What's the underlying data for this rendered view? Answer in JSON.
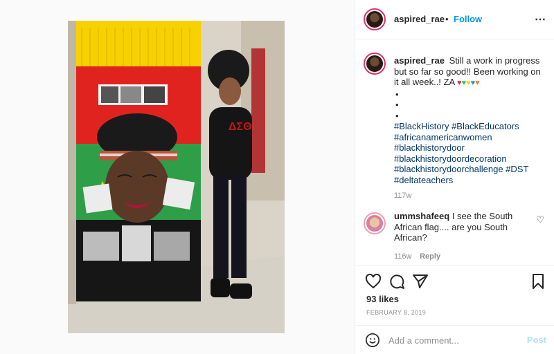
{
  "header": {
    "username": "aspired_rae",
    "separator": "•",
    "follow_label": "Follow",
    "more_icon": "more-horizontal-icon"
  },
  "caption": {
    "username": "aspired_rae",
    "text": "Still a work in progress but so far so good!! Been working on it all week..! ZA",
    "hearts": [
      "#e0245e",
      "#2ecc40",
      "#ffd000",
      "#1e90ff",
      "#ff7f1e"
    ],
    "bullets": [
      "•",
      "•",
      "•"
    ],
    "hashtags": [
      "#BlackHistory #BlackEducators",
      "#africanamericanwomen",
      "#blackhistorydoor",
      "#blackhistorydoordecoration",
      "#blackhistorydoorchallenge #DST",
      "#deltateachers"
    ],
    "time": "117w"
  },
  "comment": {
    "username": "ummshafeeq",
    "text": "I see the South African flag.... are you South African?",
    "time": "116w",
    "reply_label": "Reply"
  },
  "actions": {
    "likes": "93 likes",
    "date": "FEBRUARY 8, 2019"
  },
  "comment_bar": {
    "placeholder": "Add a comment...",
    "post_label": "Post"
  }
}
